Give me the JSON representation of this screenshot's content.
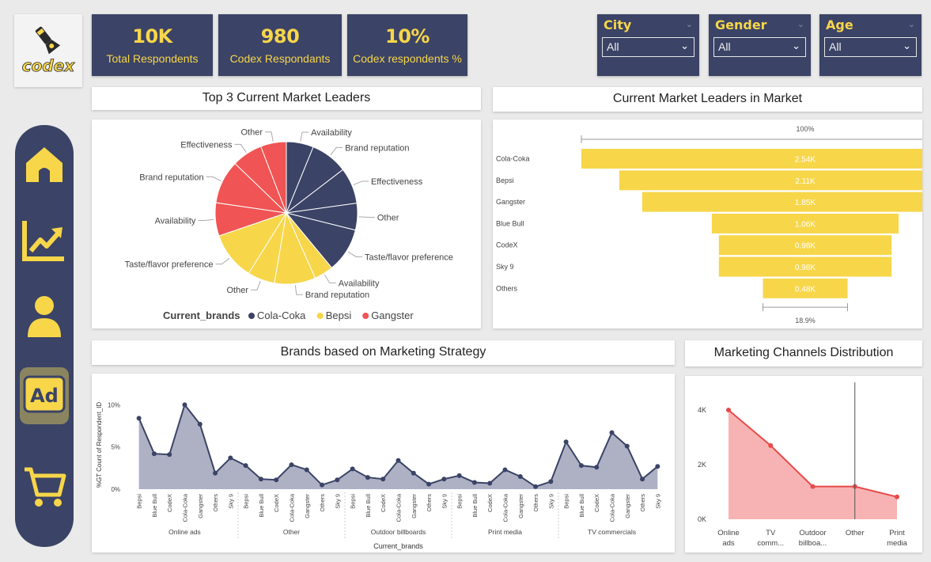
{
  "logo": {
    "text": "codex"
  },
  "kpis": [
    {
      "value": "10K",
      "label": "Total Respondents"
    },
    {
      "value": "980",
      "label": "Codex Respondants"
    },
    {
      "value": "10%",
      "label": "Codex respondents %"
    }
  ],
  "filters": [
    {
      "title": "City",
      "value": "All"
    },
    {
      "title": "Gender",
      "value": "All"
    },
    {
      "title": "Age",
      "value": "All"
    }
  ],
  "nav": [
    {
      "icon": "home-icon"
    },
    {
      "icon": "trend-chart-icon"
    },
    {
      "icon": "user-icon"
    },
    {
      "icon": "ad-icon",
      "active": true
    },
    {
      "icon": "cart-icon"
    }
  ],
  "colors": {
    "navy": "#3b4366",
    "yellow": "#f7d64a",
    "red": "#f05454",
    "area": "#f7b3b3"
  },
  "titles": {
    "pie": "Top 3 Current Market Leaders",
    "funnel": "Current Market Leaders in Market",
    "line": "Brands based on Marketing Strategy",
    "area": "Marketing Channels Distribution"
  },
  "chart_data": [
    {
      "type": "pie",
      "title": "Top 3 Current Market Leaders",
      "legend_title": "Current_brands",
      "legend_position": "bottom",
      "series_names": [
        "Cola-Coka",
        "Bepsi",
        "Gangster"
      ],
      "slices": [
        {
          "brand": "Cola-Coka",
          "label": "Availability",
          "value": 5.5
        },
        {
          "brand": "Cola-Coka",
          "label": "Brand reputation",
          "value": 7.5
        },
        {
          "brand": "Cola-Coka",
          "label": "Effectiveness",
          "value": 7.3
        },
        {
          "brand": "Cola-Coka",
          "label": "Other",
          "value": 5.4
        },
        {
          "brand": "Cola-Coka",
          "label": "Taste/flavor preference",
          "value": 9.0
        },
        {
          "brand": "Bepsi",
          "label": "Availability",
          "value": 3.9
        },
        {
          "brand": "Bepsi",
          "label": "Brand reputation",
          "value": 8.3
        },
        {
          "brand": "Bepsi",
          "label": "Other",
          "value": 5.5
        },
        {
          "brand": "Bepsi",
          "label": "Taste/flavor preference",
          "value": 9.7
        },
        {
          "brand": "Gangster",
          "label": "Availability",
          "value": 6.7
        },
        {
          "brand": "Gangster",
          "label": "Brand reputation",
          "value": 8.8
        },
        {
          "brand": "Gangster",
          "label": "Effectiveness",
          "value": 6.2
        },
        {
          "brand": "Gangster",
          "label": "Other",
          "value": 5.2
        }
      ]
    },
    {
      "type": "bar",
      "subtype": "funnel",
      "title": "Current Market Leaders in Market",
      "categories": [
        "Cola-Coka",
        "Bepsi",
        "Gangster",
        "Blue Bull",
        "CodeX",
        "Sky 9",
        "Others"
      ],
      "values": [
        2540,
        2110,
        1850,
        1060,
        980,
        980,
        480
      ],
      "value_labels": [
        "2.54K",
        "2.11K",
        "1.85K",
        "1.06K",
        "0.98K",
        "0.98K",
        "0.48K"
      ],
      "top_label": "100%",
      "bottom_label": "18.9%"
    },
    {
      "type": "line",
      "title": "Brands based on Marketing Strategy",
      "xlabel": "Current_brands",
      "ylabel": "%GT Count of Respondent_ID",
      "yticks": [
        "0%",
        "5%",
        "10%"
      ],
      "ylim": [
        0,
        10.5
      ],
      "brands": [
        "Bepsi",
        "Blue Bull",
        "CodeX",
        "Cola-Coka",
        "Gangster",
        "Others",
        "Sky 9"
      ],
      "groups": [
        "Online ads",
        "Other",
        "Outdoor billboards",
        "Print media",
        "TV commercials"
      ],
      "values": [
        [
          8.4,
          4.2,
          4.1,
          10.0,
          7.7,
          1.9,
          3.7
        ],
        [
          2.8,
          1.2,
          1.1,
          2.9,
          2.3,
          0.5,
          1.1
        ],
        [
          2.4,
          1.4,
          1.2,
          3.4,
          1.9,
          0.6,
          1.2
        ],
        [
          1.6,
          0.8,
          0.7,
          2.3,
          1.5,
          0.3,
          0.9
        ],
        [
          5.6,
          2.8,
          2.6,
          6.7,
          5.1,
          1.2,
          2.7
        ]
      ]
    },
    {
      "type": "area",
      "title": "Marketing Channels Distribution",
      "categories": [
        "Online ads",
        "TV comm...",
        "Outdoor billboa...",
        "Other",
        "Print media"
      ],
      "values": [
        4000,
        2700,
        1200,
        1200,
        820
      ],
      "yticks": [
        "0K",
        "2K",
        "4K"
      ],
      "ylim": [
        0,
        4300
      ]
    }
  ]
}
